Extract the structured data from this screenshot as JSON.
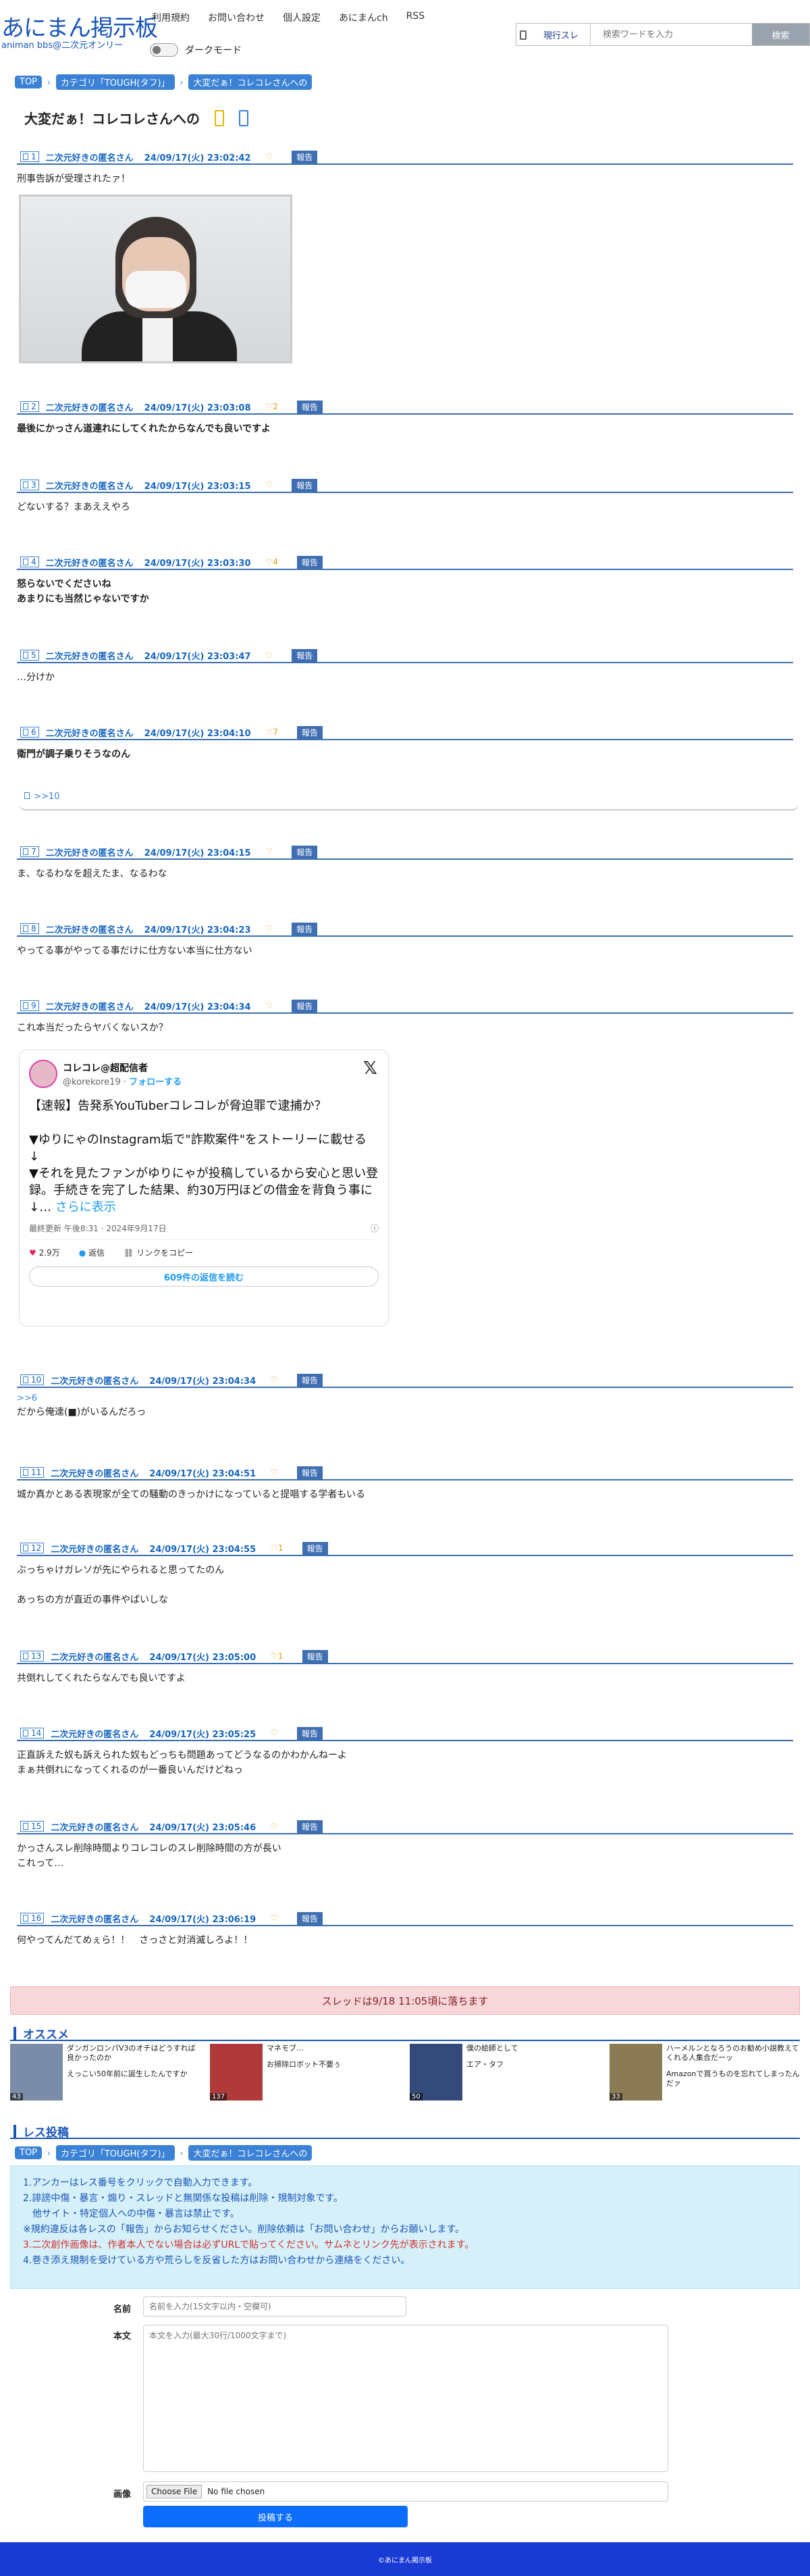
{
  "site": {
    "logo": "あにまん掲示板",
    "tagline": "animan bbs@二次元オンリー"
  },
  "nav": [
    "利用規約",
    "お問い合わせ",
    "個人設定",
    "あにまんch",
    "RSS"
  ],
  "dark_mode_label": "ダークモード",
  "search": {
    "select": "現行スレ",
    "placeholder": "検索ワードを入力",
    "button": "検索"
  },
  "breadcrumb": [
    "TOP",
    "カテゴリ「TOUGH(タフ)」",
    "大変だぁ！コレコレさんへの"
  ],
  "thread_title": "大変だぁ！コレコレさんへの",
  "report_label": "報告",
  "posts": [
    {
      "no": "1",
      "name": "二次元好きの匿名さん",
      "date": "24/09/17(火) 23:02:42",
      "likes": "",
      "body": "刑事告訴が受理されたァ！"
    },
    {
      "no": "2",
      "name": "二次元好きの匿名さん",
      "date": "24/09/17(火) 23:03:08",
      "likes": "2",
      "body": "最後にかっさん道連れにしてくれたからなんでも良いですよ"
    },
    {
      "no": "3",
      "name": "二次元好きの匿名さん",
      "date": "24/09/17(火) 23:03:15",
      "likes": "",
      "body": "どないする？まあええやろ"
    },
    {
      "no": "4",
      "name": "二次元好きの匿名さん",
      "date": "24/09/17(火) 23:03:30",
      "likes": "4",
      "body": "怒らないでくださいね\nあまりにも当然じゃないですか"
    },
    {
      "no": "5",
      "name": "二次元好きの匿名さん",
      "date": "24/09/17(火) 23:03:47",
      "likes": "",
      "body": "…分けか"
    },
    {
      "no": "6",
      "name": "二次元好きの匿名さん",
      "date": "24/09/17(火) 23:04:10",
      "likes": "7",
      "body": "衛門が調子乗りそうなのん"
    },
    {
      "no": "7",
      "name": "二次元好きの匿名さん",
      "date": "24/09/17(火) 23:04:15",
      "likes": "",
      "body": "ま、なるわなを超えたま、なるわな"
    },
    {
      "no": "8",
      "name": "二次元好きの匿名さん",
      "date": "24/09/17(火) 23:04:23",
      "likes": "",
      "body": "やってる事がやってる事だけに仕方ない本当に仕方ない"
    },
    {
      "no": "9",
      "name": "二次元好きの匿名さん",
      "date": "24/09/17(火) 23:04:34",
      "likes": "",
      "body": "これ本当だったらヤバくないスか？"
    },
    {
      "no": "10",
      "name": "二次元好きの匿名さん",
      "date": "24/09/17(火) 23:04:34",
      "likes": "",
      "body": "だから俺達(■)がいるんだろっ",
      "anchor": ">>6"
    },
    {
      "no": "11",
      "name": "二次元好きの匿名さん",
      "date": "24/09/17(火) 23:04:51",
      "likes": "",
      "body": "城か真かとある表現家が全ての騒動のきっかけになっていると提唱する学者もいる"
    },
    {
      "no": "12",
      "name": "二次元好きの匿名さん",
      "date": "24/09/17(火) 23:04:55",
      "likes": "1",
      "body": "ぶっちゃけガレソが先にやられると思ってたのん\n\nあっちの方が直近の事件やばいしな"
    },
    {
      "no": "13",
      "name": "二次元好きの匿名さん",
      "date": "24/09/17(火) 23:05:00",
      "likes": "1",
      "body": "共倒れしてくれたらなんでも良いですよ"
    },
    {
      "no": "14",
      "name": "二次元好きの匿名さん",
      "date": "24/09/17(火) 23:05:25",
      "likes": "",
      "body": "正直訴えた奴も訴えられた奴もどっちも問題あってどうなるのかわかんねーよ\nまぁ共倒れになってくれるのが一番良いんだけどねっ"
    },
    {
      "no": "15",
      "name": "二次元好きの匿名さん",
      "date": "24/09/17(火) 23:05:46",
      "likes": "",
      "body": "かっさんスレ削除時間よりコレコレのスレ削除時間の方が長い\nこれって…"
    },
    {
      "no": "16",
      "name": "二次元好きの匿名さん",
      "date": "24/09/17(火) 23:06:19",
      "likes": "",
      "body": "何やってんだてめぇら！！　さっさと対消滅しろよ！！"
    }
  ],
  "reply_link": ">>10",
  "tweet": {
    "name": "コレコレ@超配信者",
    "handle": "@korekore19",
    "follow": "フォローする",
    "text": "【速報】告発系YouTuberコレコレが脅迫罪で逮捕か？\n\n▼ゆりにゃのInstagram垢で\"詐欺案件\"をストーリーに載せる\n↓\n▼それを見たファンがゆりにゃが投稿しているから安心と思い登録。手続きを完了した結果、約30万円ほどの借金を背負う事に\n↓…",
    "more": "さらに表示",
    "meta": "最終更新 午後8:31 · 2024年9月17日",
    "likes": "2.9万",
    "reply": "返信",
    "copy": "リンクをコピー",
    "read": "609件の返信を読む"
  },
  "notice": "スレッドは9/18 11:05頃に落ちます",
  "recommend_title": "オススメ",
  "recommend": [
    {
      "title": "ダンガンロンパV3のオチはどうすれば良かったのか",
      "count": "43",
      "title2": "えっこい50年前に誕生したんですか"
    },
    {
      "title": "マネモブ…",
      "count": "137",
      "title2": "お掃除ロボット不要ぅ"
    },
    {
      "title": "僕の絵師として",
      "count": "50",
      "title2": "エア・タフ"
    },
    {
      "title": "ハーメルンとなろうのお勧め小説教えてくれる人集合だーッ",
      "count": "33",
      "title2": "Amazonで買うものを忘れてしまったんだァ"
    }
  ],
  "post_title": "レス投稿",
  "rules": [
    "1.アンカーはレス番号をクリックで自動入力できます。",
    "2.誹謗中傷・暴言・煽り・スレッドと無関係な投稿は削除・規制対象です。",
    "　他サイト・特定個人への中傷・暴言は禁止です。",
    "※規約違反は各レスの「報告」からお知らせください。削除依頼は「お問い合わせ」からお願いします。",
    "3.二次創作画像は、作者本人でない場合は必ずURLで貼ってください。サムネとリンク先が表示されます。",
    "4.巻き添え規制を受けている方や荒らしを反省した方はお問い合わせから連絡をください。"
  ],
  "form": {
    "name_label": "名前",
    "name_ph": "名前を入力(15文字以内・空欄可)",
    "body_label": "本文",
    "body_ph": "本文を入力(最大30行/1000文字まで)",
    "image_label": "画像",
    "file_btn": "Choose File",
    "file_none": "No file chosen",
    "submit": "投稿する"
  },
  "footer": "©あにまん掲示板",
  "colors": {
    "accent": "#3b82d6",
    "header_line": "#3b6fb0",
    "notice_bg": "#f8d7da",
    "rules_bg": "#d5f0f8",
    "footer": "#1a3ad4"
  }
}
